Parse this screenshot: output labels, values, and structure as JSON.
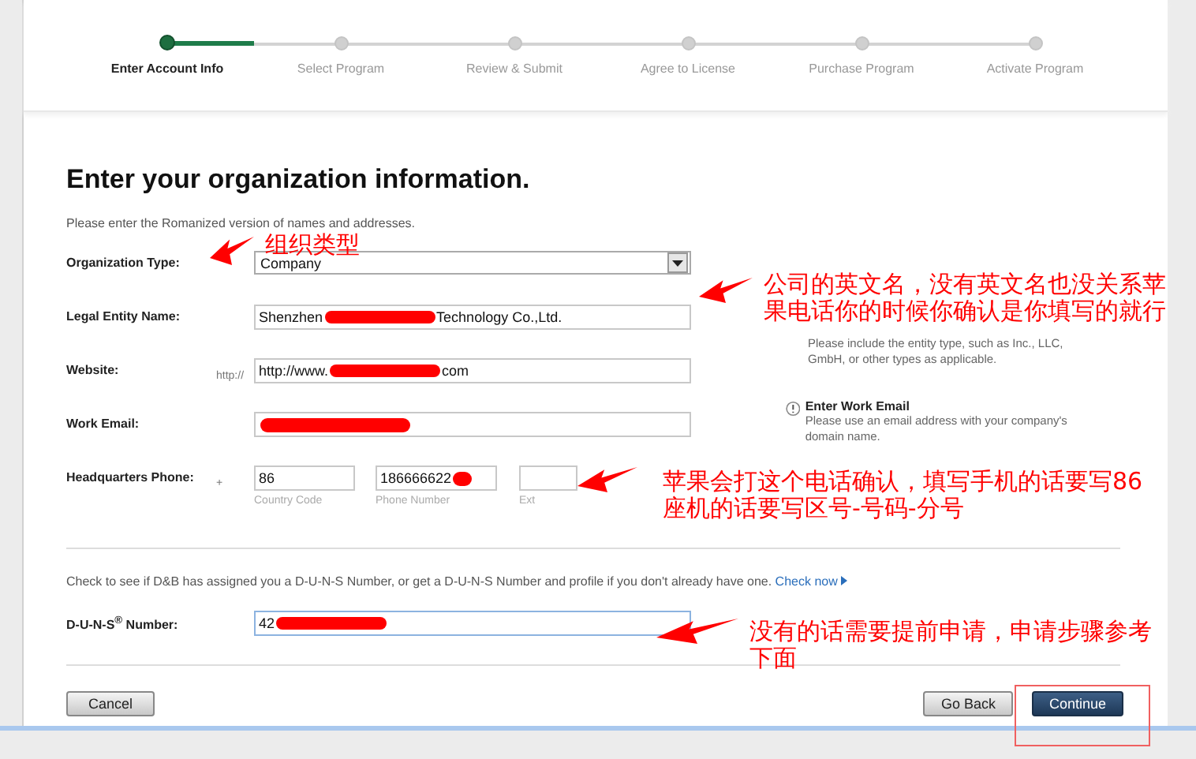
{
  "stepper": [
    {
      "label": "Enter Account Info",
      "selected": true
    },
    {
      "label": "Select Program",
      "selected": false
    },
    {
      "label": "Review & Submit",
      "selected": false
    },
    {
      "label": "Agree to License",
      "selected": false
    },
    {
      "label": "Purchase Program",
      "selected": false
    },
    {
      "label": "Activate Program",
      "selected": false
    }
  ],
  "heading": "Enter your organization information.",
  "intro": "Please enter the Romanized version of names and addresses.",
  "fields": [
    {
      "kind": "select",
      "label": "Organization Type:",
      "value": "Company"
    },
    {
      "kind": "text",
      "label": "Legal Entity Name:",
      "value": "Shenzhen",
      "value_end": "Technology Co.,Ltd.",
      "redacted": true,
      "hint": {
        "text": "Please include the entity type, such as Inc., LLC, GmbH, or other types as applicable."
      }
    },
    {
      "kind": "text",
      "label": "Website:",
      "prefix": "http://",
      "value": "http://www.",
      "value_end": "com",
      "redacted": true
    },
    {
      "kind": "text",
      "label": "Work Email:",
      "redacted": true,
      "hint": {
        "title": "Enter Work Email",
        "text": "Please use an email address with your company's domain name."
      }
    },
    {
      "kind": "phone",
      "label": "Headquarters Phone:",
      "prefix": "+",
      "parts": [
        {
          "value": "86",
          "caption": "Country Code"
        },
        {
          "value": "186666622",
          "caption": "Phone Number",
          "redacted": true
        },
        {
          "caption": "Ext"
        }
      ]
    }
  ],
  "duns_note": {
    "text": "Check to see if D&B has assigned you a D-U-N-S Number, or get a D-U-N-S Number and profile if you don't already have one.",
    "link": "Check now"
  },
  "duns": {
    "label": "D-U-N-S$^{®}$ Number:",
    "value": "42",
    "redacted": true,
    "focused": true
  },
  "buttons": [
    {
      "label": "Cancel",
      "kind": "secondary"
    },
    {
      "label": "Go Back",
      "kind": "secondary"
    },
    {
      "label": "Continue",
      "kind": "primary"
    }
  ],
  "annotations": [
    {
      "text": "组织类型"
    },
    {
      "text": "公司的英文名，没有英文名也没关系苹果电话你的时候你确认是你填写的就行"
    },
    {
      "text": "苹果会打这个电话确认，填写手机的话要写86座机的话要写区号-号码-分号"
    },
    {
      "text": "没有的话需要提前申请，申请步骤参考下面"
    }
  ]
}
